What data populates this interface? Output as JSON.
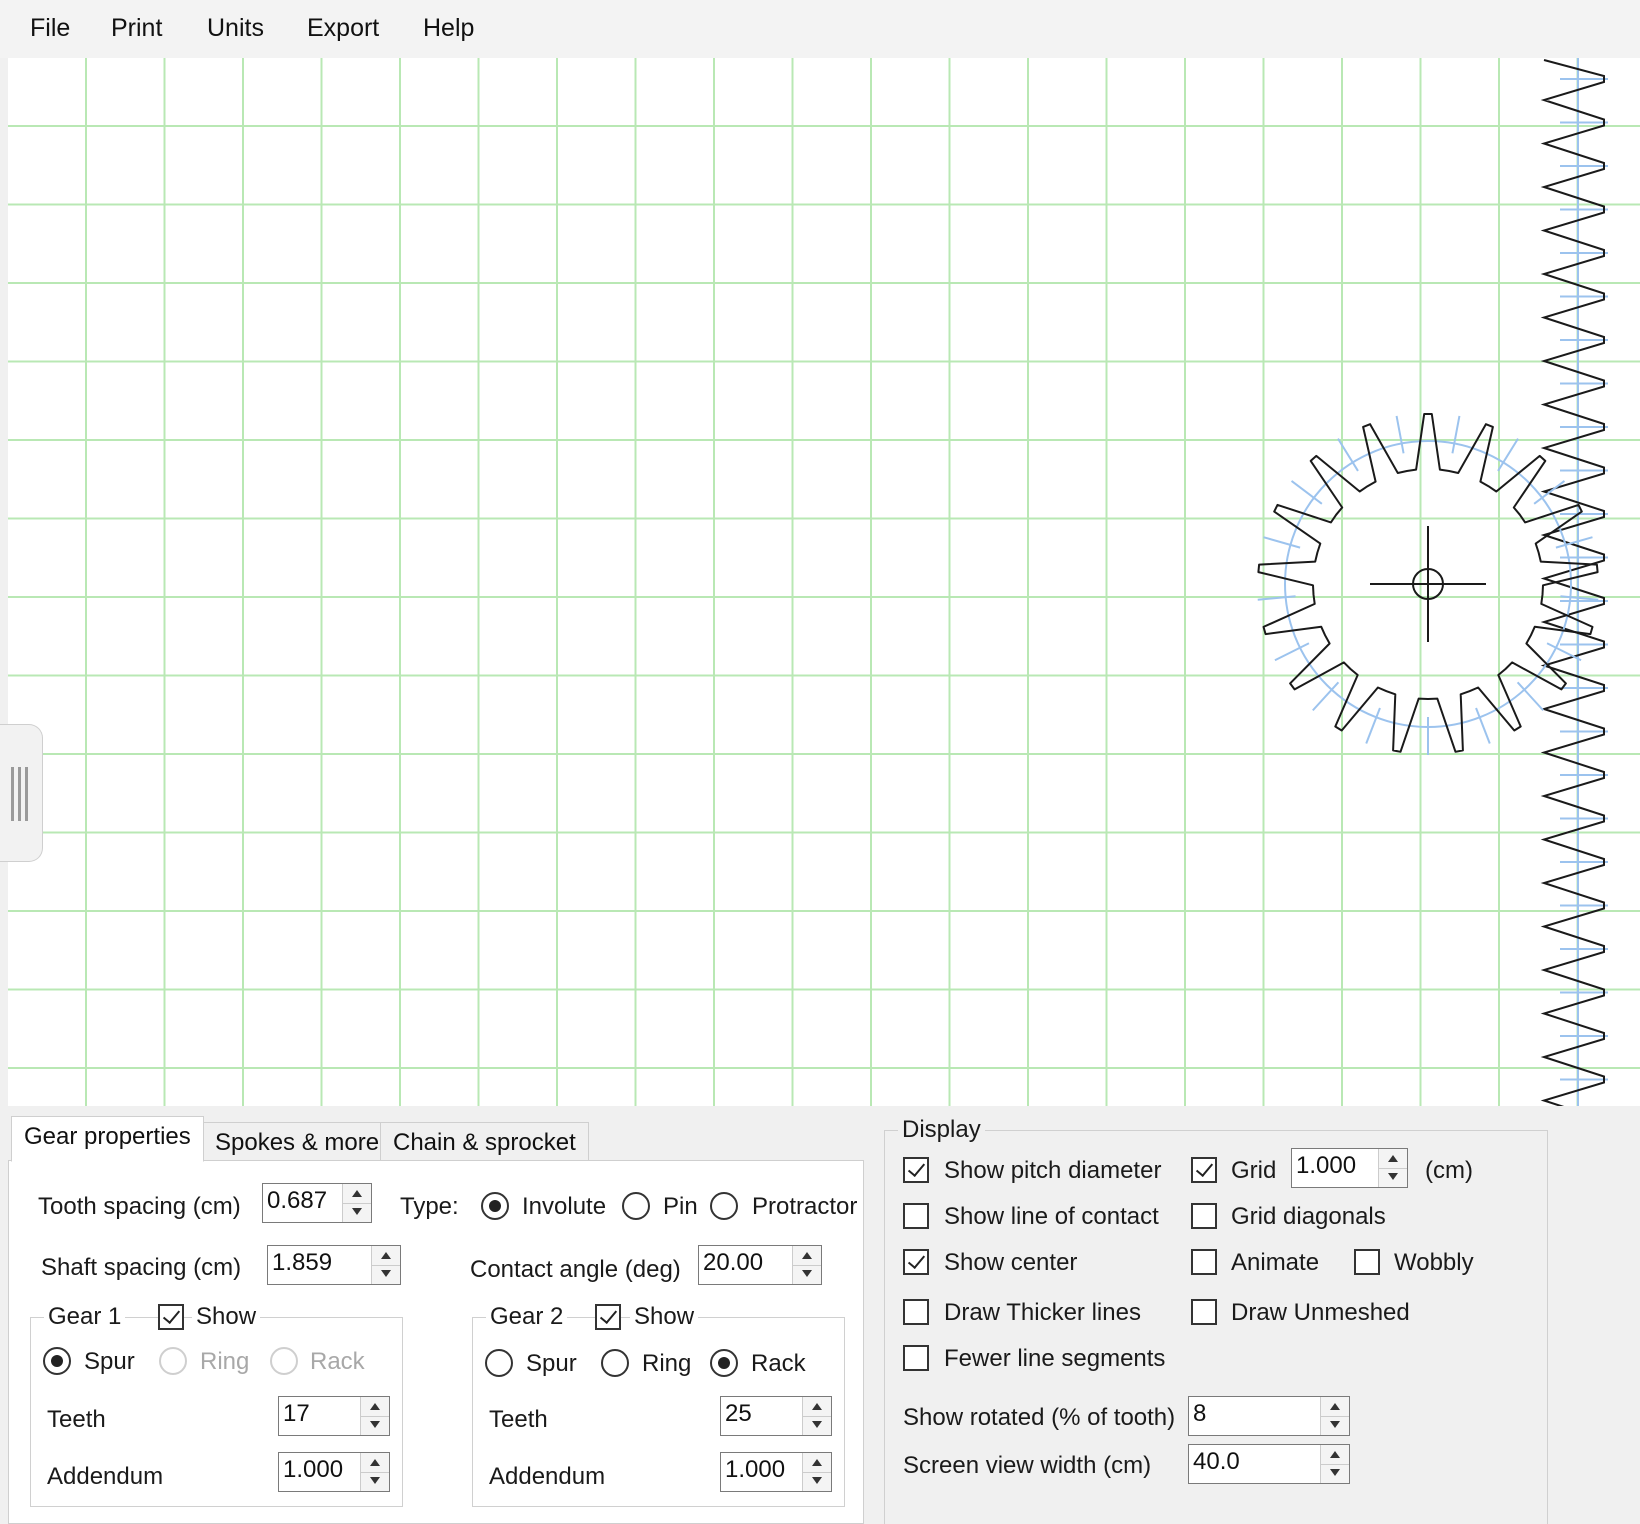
{
  "menu": [
    "File",
    "Print",
    "Units",
    "Export",
    "Help"
  ],
  "tabs": [
    "Gear properties",
    "Spokes & more",
    "Chain & sprocket"
  ],
  "gear_props": {
    "tooth_spacing_label": "Tooth spacing (cm)",
    "tooth_spacing": "0.687",
    "shaft_spacing_label": "Shaft spacing (cm)",
    "shaft_spacing": "1.859",
    "type_label": "Type:",
    "type_options": [
      "Involute",
      "Pin",
      "Protractor"
    ],
    "type_selected": "Involute",
    "contact_angle_label": "Contact angle (deg)",
    "contact_angle": "20.00"
  },
  "gear1": {
    "title": "Gear 1",
    "show_label": "Show",
    "show": true,
    "kinds": [
      "Spur",
      "Ring",
      "Rack"
    ],
    "kind_selected": "Spur",
    "teeth_label": "Teeth",
    "teeth": "17",
    "addendum_label": "Addendum",
    "addendum": "1.000"
  },
  "gear2": {
    "title": "Gear 2",
    "show_label": "Show",
    "show": true,
    "kinds": [
      "Spur",
      "Ring",
      "Rack"
    ],
    "kind_selected": "Rack",
    "teeth_label": "Teeth",
    "teeth": "25",
    "addendum_label": "Addendum",
    "addendum": "1.000"
  },
  "display": {
    "title": "Display",
    "show_pitch_diameter": {
      "label": "Show pitch diameter",
      "checked": true
    },
    "show_line_of_contact": {
      "label": "Show line of contact",
      "checked": false
    },
    "show_center": {
      "label": "Show center",
      "checked": true
    },
    "draw_thicker_lines": {
      "label": "Draw Thicker lines",
      "checked": false
    },
    "fewer_line_segments": {
      "label": "Fewer line segments",
      "checked": false
    },
    "grid": {
      "label": "Grid",
      "checked": true,
      "value": "1.000",
      "unit": "(cm)"
    },
    "grid_diagonals": {
      "label": "Grid diagonals",
      "checked": false
    },
    "animate": {
      "label": "Animate",
      "checked": false
    },
    "wobbly": {
      "label": "Wobbly",
      "checked": false
    },
    "draw_unmeshed": {
      "label": "Draw Unmeshed",
      "checked": false
    },
    "show_rotated_label": "Show rotated (% of tooth)",
    "show_rotated": "8",
    "screen_view_width_label": "Screen view width (cm)",
    "screen_view_width": "40.0"
  },
  "colors": {
    "grid": "#b9e8b4",
    "gear_outline": "#1a1a1a",
    "pitch": "#9cc3ee",
    "window_bg": "#f0f0f0"
  },
  "icons": {
    "spin_up": "triangle-up",
    "spin_down": "triangle-down",
    "center_marker": "crosshair-circle",
    "side_grip": "vertical-grip"
  }
}
